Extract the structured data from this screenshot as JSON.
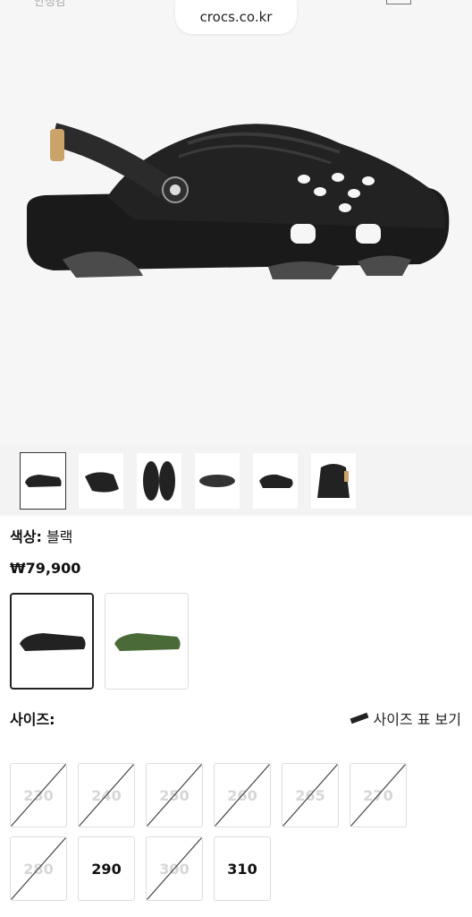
{
  "browser": {
    "url": "crocs.co.kr",
    "top_left_fragment": "안정감"
  },
  "product": {
    "color_label": "색상:",
    "color_value": "블랙",
    "price": "₩79,900"
  },
  "thumbnails": [
    "black-clog-side",
    "black-clog-angle",
    "black-clog-top",
    "black-clog-sole",
    "black-clog-front",
    "black-clog-back"
  ],
  "swatches": [
    {
      "name": "black",
      "selected": true
    },
    {
      "name": "army-green",
      "selected": false
    }
  ],
  "sizes_section": {
    "label": "사이즈:",
    "guide_link": "사이즈 표 보기"
  },
  "sizes": [
    {
      "label": "230",
      "available": false
    },
    {
      "label": "240",
      "available": false
    },
    {
      "label": "250",
      "available": false
    },
    {
      "label": "260",
      "available": false
    },
    {
      "label": "265",
      "available": false
    },
    {
      "label": "270",
      "available": false
    },
    {
      "label": "280",
      "available": false
    },
    {
      "label": "290",
      "available": true
    },
    {
      "label": "300",
      "available": false
    },
    {
      "label": "310",
      "available": true
    }
  ]
}
